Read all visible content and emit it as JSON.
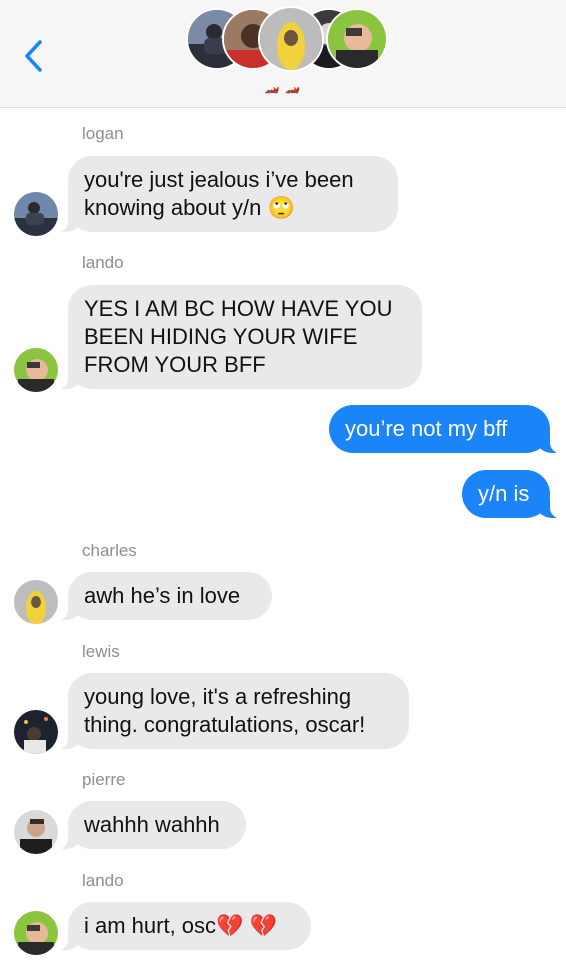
{
  "header": {
    "back_icon": "chevron-left-icon",
    "group_name": "🏎️ 🏎️",
    "accent": "#1a84f8",
    "members": [
      "lewis",
      "charles",
      "pierre",
      "logan",
      "lando"
    ]
  },
  "messages": [
    {
      "sender": "logan",
      "text": "you're just jealous i’ve been knowing about y/n 🙄",
      "direction": "incoming"
    },
    {
      "sender": "lando",
      "text": "YES I AM BC HOW HAVE YOU BEEN HIDING YOUR WIFE FROM YOUR BFF",
      "direction": "incoming"
    },
    {
      "text": "you’re not my bff",
      "direction": "outgoing"
    },
    {
      "text": "y/n is",
      "direction": "outgoing"
    },
    {
      "sender": "charles",
      "text": "awh he’s in love",
      "direction": "incoming"
    },
    {
      "sender": "lewis",
      "text": "young love, it's a refreshing thing. congratulations, oscar!",
      "direction": "incoming"
    },
    {
      "sender": "pierre",
      "text": "wahhh wahhh",
      "direction": "incoming"
    },
    {
      "sender": "lando",
      "text": "i am hurt, osc💔 💔",
      "direction": "incoming"
    }
  ],
  "colors": {
    "incoming_bubble": "#e9e9eb",
    "outgoing_bubble": "#1a84f8",
    "sender_label": "#8e8e93",
    "header_bg": "#f6f6f6"
  }
}
